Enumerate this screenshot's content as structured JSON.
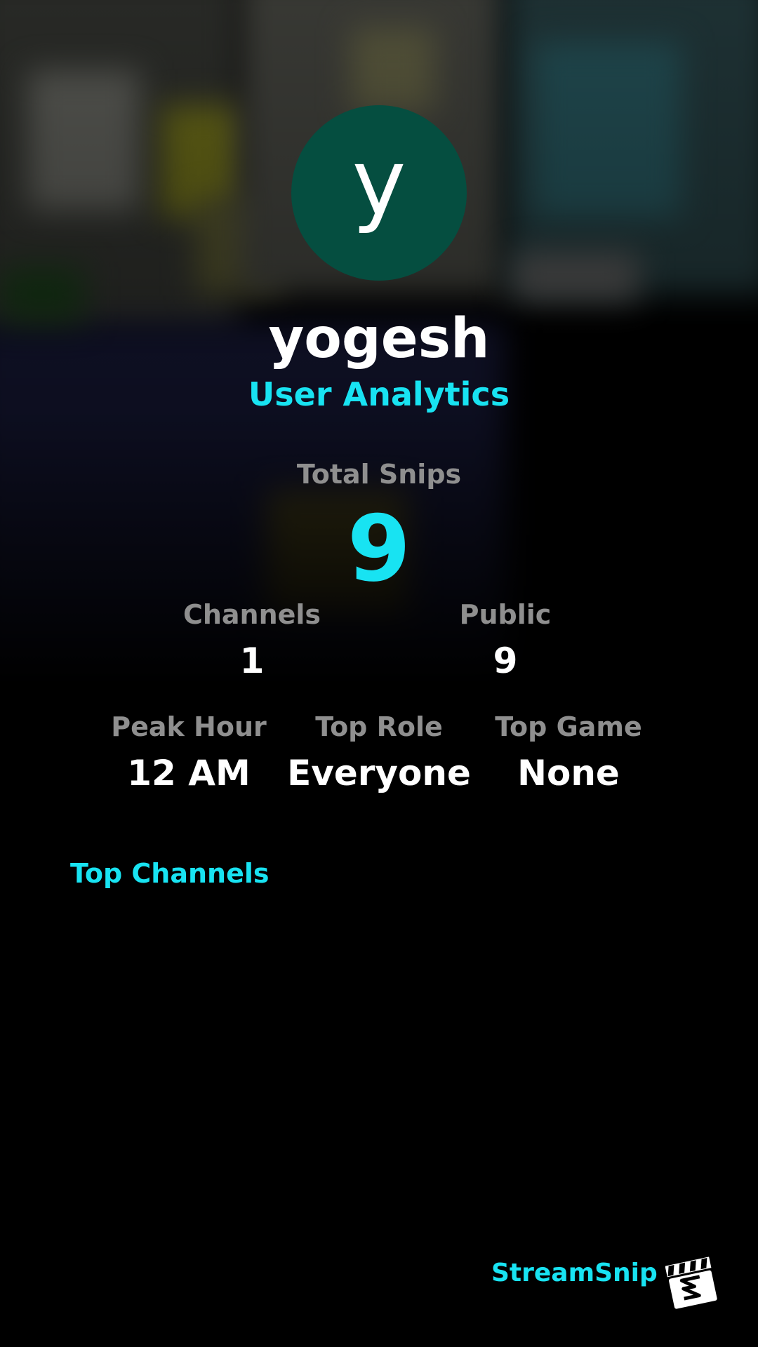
{
  "profile": {
    "avatar_letter": "y",
    "avatar_color": "#054e40",
    "username": "yogesh",
    "subtitle": "User Analytics"
  },
  "stats": {
    "total_snips_label": "Total Snips",
    "total_snips_value": "9",
    "channels_label": "Channels",
    "channels_value": "1",
    "public_label": "Public",
    "public_value": "9",
    "peak_hour_label": "Peak Hour",
    "peak_hour_value": "12 AM",
    "top_role_label": "Top Role",
    "top_role_value": "Everyone",
    "top_game_label": "Top Game",
    "top_game_value": "None"
  },
  "sections": {
    "top_channels_title": "Top Channels"
  },
  "branding": {
    "name": "StreamSnip",
    "logo_icon": "clapperboard-icon"
  },
  "colors": {
    "accent": "#18e3f2",
    "label": "#8f8f8f",
    "background": "#000000"
  }
}
